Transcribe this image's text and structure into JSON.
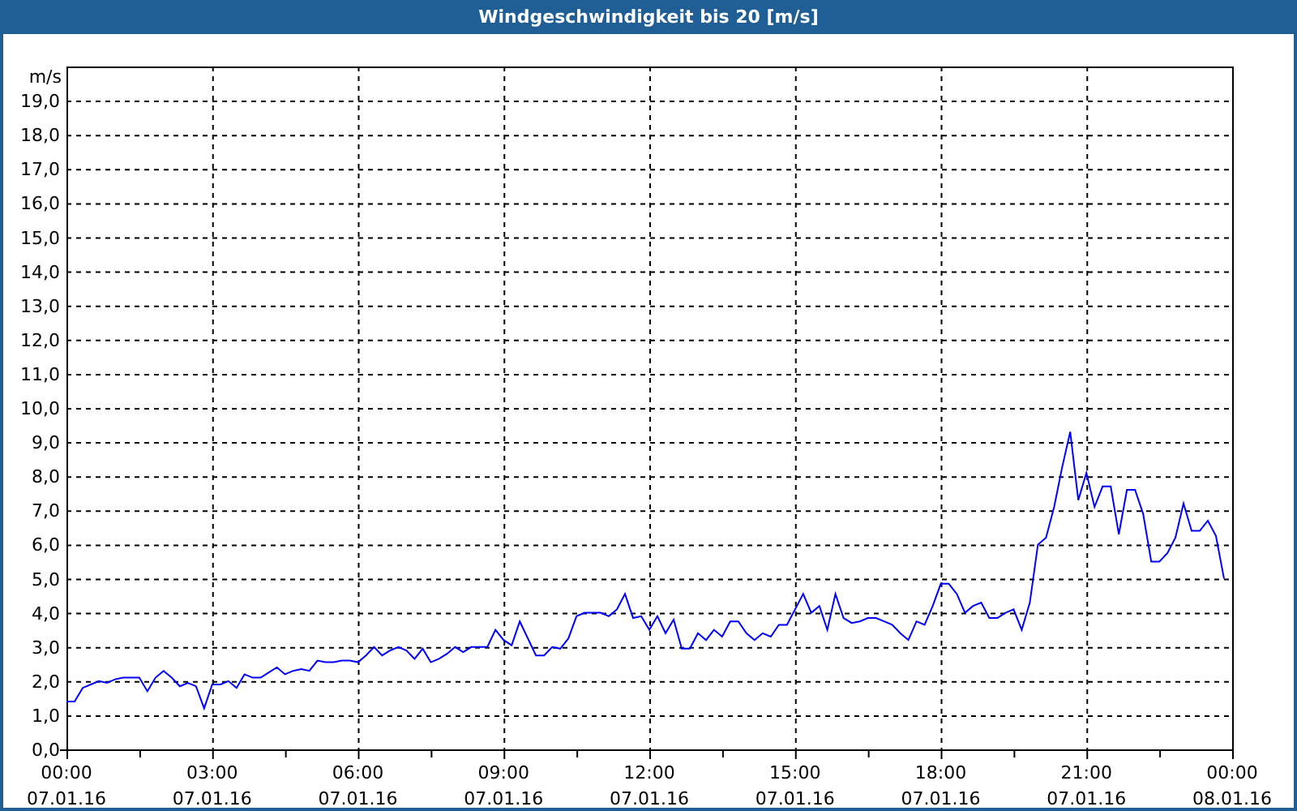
{
  "window": {
    "title": "Windgeschwindigkeit bis 20 [m/s]"
  },
  "chart_data": {
    "type": "line",
    "grid": true,
    "ylabel": "m/s",
    "ylim": [
      0,
      20
    ],
    "yticks": [
      {
        "value": 0,
        "label": "0,0"
      },
      {
        "value": 1,
        "label": "1,0"
      },
      {
        "value": 2,
        "label": "2,0"
      },
      {
        "value": 3,
        "label": "3,0"
      },
      {
        "value": 4,
        "label": "4,0"
      },
      {
        "value": 5,
        "label": "5,0"
      },
      {
        "value": 6,
        "label": "6,0"
      },
      {
        "value": 7,
        "label": "7,0"
      },
      {
        "value": 8,
        "label": "8,0"
      },
      {
        "value": 9,
        "label": "9,0"
      },
      {
        "value": 10,
        "label": "10,0"
      },
      {
        "value": 11,
        "label": "11,0"
      },
      {
        "value": 12,
        "label": "12,0"
      },
      {
        "value": 13,
        "label": "13,0"
      },
      {
        "value": 14,
        "label": "14,0"
      },
      {
        "value": 15,
        "label": "15,0"
      },
      {
        "value": 16,
        "label": "16,0"
      },
      {
        "value": 17,
        "label": "17,0"
      },
      {
        "value": 18,
        "label": "18,0"
      },
      {
        "value": 19,
        "label": "19,0"
      }
    ],
    "categories": [
      "00:00\n07.01.16",
      null,
      null,
      null,
      null,
      null,
      null,
      null,
      null,
      null,
      null,
      null,
      null,
      null,
      null,
      null,
      null,
      null,
      "03:00\n07.01.16",
      null,
      null,
      null,
      null,
      null,
      null,
      null,
      null,
      null,
      null,
      null,
      null,
      null,
      null,
      null,
      null,
      null,
      "06:00\n07.01.16",
      null,
      null,
      null,
      null,
      null,
      null,
      null,
      null,
      null,
      null,
      null,
      null,
      null,
      null,
      null,
      null,
      null,
      "09:00\n07.01.16",
      null,
      null,
      null,
      null,
      null,
      null,
      null,
      null,
      null,
      null,
      null,
      null,
      null,
      null,
      null,
      null,
      null,
      "12:00\n07.01.16",
      null,
      null,
      null,
      null,
      null,
      null,
      null,
      null,
      null,
      null,
      null,
      null,
      null,
      null,
      null,
      null,
      null,
      "15:00\n07.01.16",
      null,
      null,
      null,
      null,
      null,
      null,
      null,
      null,
      null,
      null,
      null,
      null,
      null,
      null,
      null,
      null,
      null,
      "18:00\n07.01.16",
      null,
      null,
      null,
      null,
      null,
      null,
      null,
      null,
      null,
      null,
      null,
      null,
      null,
      null,
      null,
      null,
      null,
      "21:00\n07.01.16",
      null,
      null,
      null,
      null,
      null,
      null,
      null,
      null,
      null,
      null,
      null,
      null,
      null,
      null,
      null,
      null,
      null,
      "00:00\n08.01.16"
    ],
    "values": [
      1.4,
      1.4,
      1.8,
      1.9,
      2.0,
      1.95,
      2.05,
      2.1,
      2.1,
      2.1,
      1.7,
      2.1,
      2.3,
      2.1,
      1.85,
      1.95,
      1.85,
      1.2,
      1.9,
      1.9,
      2.0,
      1.8,
      2.2,
      2.1,
      2.1,
      2.25,
      2.4,
      2.2,
      2.3,
      2.35,
      2.3,
      2.6,
      2.55,
      2.55,
      2.6,
      2.6,
      2.55,
      2.75,
      3.0,
      2.75,
      2.9,
      3.0,
      2.9,
      2.65,
      2.95,
      2.55,
      2.65,
      2.8,
      3.0,
      2.85,
      3.0,
      3.0,
      3.0,
      3.5,
      3.2,
      3.05,
      3.75,
      3.25,
      2.75,
      2.75,
      3.0,
      2.95,
      3.25,
      3.9,
      4.0,
      4.0,
      4.0,
      3.9,
      4.1,
      4.55,
      3.85,
      3.9,
      3.5,
      3.9,
      3.4,
      3.8,
      2.95,
      2.95,
      3.4,
      3.2,
      3.5,
      3.3,
      3.75,
      3.75,
      3.4,
      3.2,
      3.4,
      3.3,
      3.65,
      3.65,
      4.1,
      4.55,
      4.0,
      4.2,
      3.5,
      4.55,
      3.85,
      3.7,
      3.75,
      3.85,
      3.85,
      3.75,
      3.65,
      3.4,
      3.2,
      3.75,
      3.65,
      4.2,
      4.85,
      4.85,
      4.55,
      4.0,
      4.2,
      4.3,
      3.85,
      3.85,
      4.0,
      4.1,
      3.5,
      4.3,
      6.0,
      6.2,
      7.1,
      8.25,
      9.3,
      7.3,
      8.1,
      7.1,
      7.7,
      7.7,
      6.3,
      7.6,
      7.6,
      6.9,
      5.5,
      5.5,
      5.75,
      6.2,
      7.2,
      6.4,
      6.4,
      6.7,
      6.25,
      5.0,
      null
    ]
  }
}
